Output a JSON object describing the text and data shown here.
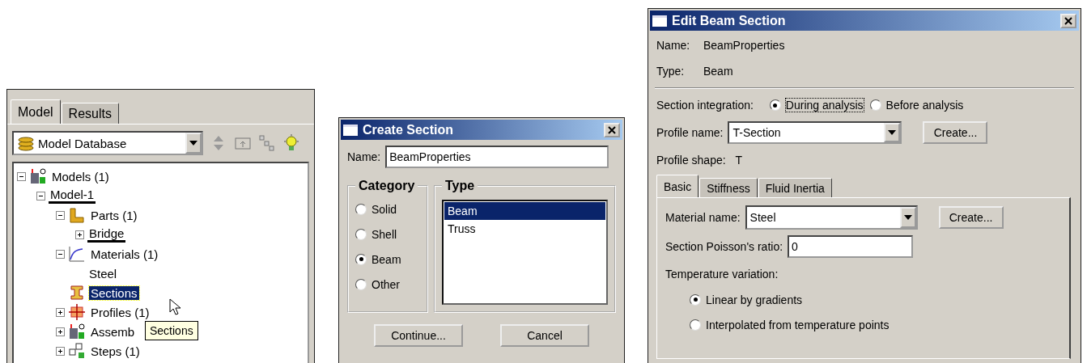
{
  "model_tree_panel": {
    "tabs": [
      {
        "label": "Model",
        "selected": true
      },
      {
        "label": "Results",
        "selected": false
      }
    ],
    "database_selector": {
      "value": "Model Database"
    },
    "tree": [
      {
        "label": "Models (1)",
        "kind": "models",
        "expanded": true,
        "underlined": false,
        "selected": false,
        "children": [
          {
            "label": "Model-1",
            "expanded": true,
            "underlined": true,
            "selected": false,
            "children": [
              {
                "label": "Parts (1)",
                "kind": "parts",
                "expanded": true,
                "underlined": false,
                "selected": false,
                "children": [
                  {
                    "label": "Bridge",
                    "expanded": false,
                    "underlined": true,
                    "selected": false
                  }
                ]
              },
              {
                "label": "Materials (1)",
                "kind": "materials",
                "expanded": true,
                "underlined": false,
                "selected": false,
                "children": [
                  {
                    "label": "Steel",
                    "underlined": false,
                    "selected": false
                  }
                ]
              },
              {
                "label": "Sections",
                "kind": "sections",
                "underlined": false,
                "selected": true
              },
              {
                "label": "Profiles (1)",
                "kind": "profiles",
                "expanded": false,
                "underlined": false,
                "selected": false
              },
              {
                "label": "Assemb",
                "kind": "assembly",
                "expanded": false,
                "underlined": false,
                "selected": false
              },
              {
                "label": "Steps (1)",
                "kind": "steps",
                "expanded": false,
                "underlined": false,
                "selected": false
              }
            ]
          }
        ]
      }
    ],
    "tooltip": "Sections"
  },
  "create_section": {
    "title": "Create Section",
    "name_field": {
      "label": "Name:",
      "value": "BeamProperties"
    },
    "category": {
      "title": "Category",
      "options": [
        {
          "label": "Solid",
          "selected": false
        },
        {
          "label": "Shell",
          "selected": false
        },
        {
          "label": "Beam",
          "selected": true
        },
        {
          "label": "Other",
          "selected": false
        }
      ]
    },
    "type": {
      "title": "Type",
      "items": [
        {
          "label": "Beam",
          "selected": true
        },
        {
          "label": "Truss",
          "selected": false
        }
      ]
    },
    "buttons": [
      "Continue...",
      "Cancel"
    ]
  },
  "edit_beam_section": {
    "title": "Edit Beam Section",
    "info": [
      {
        "label": "Name:",
        "value": "BeamProperties"
      },
      {
        "label": "Type:",
        "value": "Beam"
      }
    ],
    "section_integration": {
      "label": "Section integration:",
      "options": [
        {
          "label": "During analysis",
          "selected": true
        },
        {
          "label": "Before analysis",
          "selected": false
        }
      ]
    },
    "profile_name": {
      "label": "Profile name:",
      "value": "T-Section",
      "button": "Create..."
    },
    "profile_shape": {
      "label": "Profile shape:",
      "value": "T"
    },
    "tabs": [
      {
        "label": "Basic",
        "selected": true
      },
      {
        "label": "Stiffness",
        "selected": false
      },
      {
        "label": "Fluid Inertia",
        "selected": false
      }
    ],
    "material_name": {
      "label": "Material name:",
      "value": "Steel",
      "button": "Create..."
    },
    "poisson_ratio": {
      "label": "Section Poisson's ratio:",
      "value": "0"
    },
    "temperature_variation": {
      "label": "Temperature variation:",
      "options": [
        {
          "label": "Linear by gradients",
          "selected": true
        },
        {
          "label": "Interpolated from temperature points",
          "selected": false
        }
      ]
    }
  }
}
